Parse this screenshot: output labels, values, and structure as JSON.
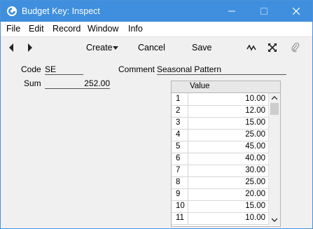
{
  "window": {
    "title": "Budget Key: Inspect"
  },
  "menu": [
    "File",
    "Edit",
    "Record",
    "Window",
    "Info"
  ],
  "toolbar": {
    "create_label": "Create",
    "cancel_label": "Cancel",
    "save_label": "Save"
  },
  "form": {
    "code_label": "Code",
    "code_value": "SE",
    "comment_label": "Comment",
    "comment_value": "Seasonal Pattern",
    "sum_label": "Sum",
    "sum_value": "252.00"
  },
  "table": {
    "header": "Value",
    "rows": [
      {
        "n": "1",
        "v": "10.00"
      },
      {
        "n": "2",
        "v": "12.00"
      },
      {
        "n": "3",
        "v": "15.00"
      },
      {
        "n": "4",
        "v": "25.00"
      },
      {
        "n": "5",
        "v": "45.00"
      },
      {
        "n": "6",
        "v": "40.00"
      },
      {
        "n": "7",
        "v": "30.00"
      },
      {
        "n": "8",
        "v": "25.00"
      },
      {
        "n": "9",
        "v": "20.00"
      },
      {
        "n": "10",
        "v": "15.00"
      },
      {
        "n": "11",
        "v": "10.00"
      }
    ]
  },
  "colors": {
    "titlebar": "#3f8fde"
  },
  "icons": [
    "app-icon",
    "minimize-icon",
    "maximize-icon",
    "close-icon",
    "arrow-left-icon",
    "arrow-right-icon",
    "dropdown-caret-icon",
    "activity-icon",
    "expand-icon",
    "paperclip-icon",
    "scroll-up-icon",
    "scroll-down-icon"
  ]
}
